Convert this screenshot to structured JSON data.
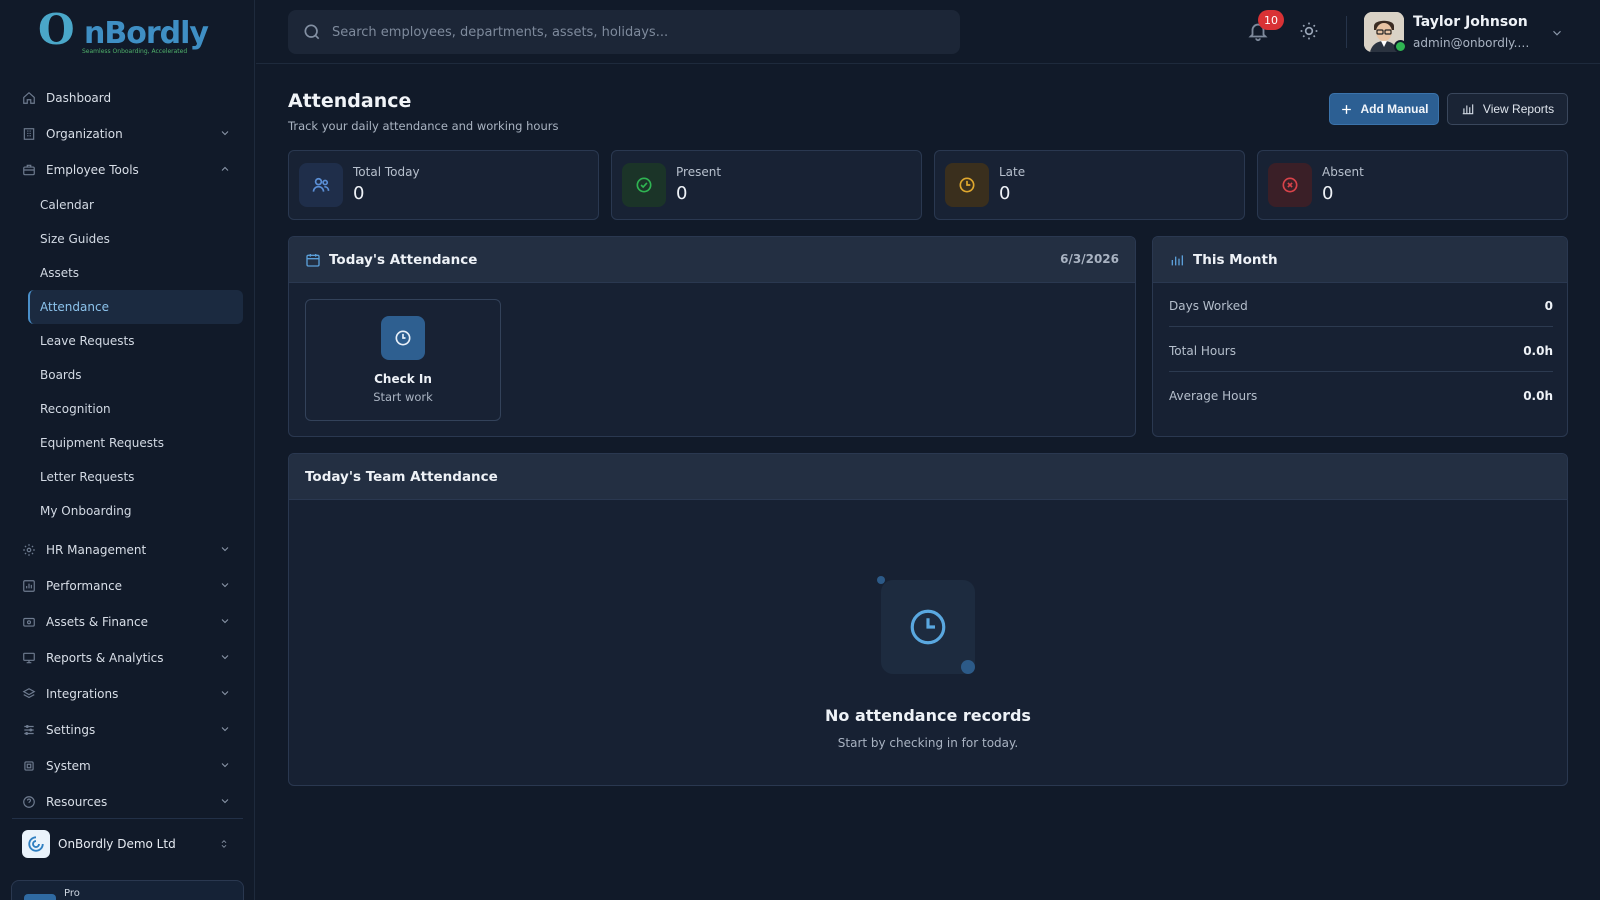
{
  "app": {
    "logo_mark": "O",
    "logo_word": "nBordly",
    "tagline": "Seamless Onboarding, Accelerated"
  },
  "sidebar": {
    "items_top": [
      {
        "label": "Dashboard",
        "icon": "home-icon",
        "expandable": false
      },
      {
        "label": "Organization",
        "icon": "building-icon",
        "expandable": true
      },
      {
        "label": "Employee Tools",
        "icon": "briefcase-icon",
        "expandable": true,
        "expanded": true
      }
    ],
    "employee_tools": [
      "Calendar",
      "Size Guides",
      "Assets",
      "Attendance",
      "Leave Requests",
      "Boards",
      "Recognition",
      "Equipment Requests",
      "Letter Requests",
      "My Onboarding"
    ],
    "active_sub": "Attendance",
    "items_bottom": [
      {
        "label": "HR Management",
        "icon": "users-cog-icon"
      },
      {
        "label": "Performance",
        "icon": "chart-icon"
      },
      {
        "label": "Assets & Finance",
        "icon": "wallet-icon"
      },
      {
        "label": "Reports & Analytics",
        "icon": "report-icon"
      },
      {
        "label": "Integrations",
        "icon": "layers-icon"
      },
      {
        "label": "Settings",
        "icon": "sliders-icon"
      },
      {
        "label": "System",
        "icon": "cpu-icon"
      },
      {
        "label": "Resources",
        "icon": "help-icon"
      }
    ],
    "org_name": "OnBordly Demo Ltd",
    "plan_label": "Pro"
  },
  "topbar": {
    "search_placeholder": "Search employees, departments, assets, holidays...",
    "notification_count": "10",
    "user_name": "Taylor Johnson",
    "user_email": "admin@onbordly.de..."
  },
  "page": {
    "title": "Attendance",
    "subtitle": "Track your daily attendance and working hours",
    "add_manual_label": "Add Manual",
    "view_reports_label": "View Reports"
  },
  "stats": [
    {
      "label": "Total Today",
      "value": "0",
      "color": "#4a7fc1",
      "icon": "users-icon"
    },
    {
      "label": "Present",
      "value": "0",
      "color": "#2fb552",
      "icon": "check-circle-icon"
    },
    {
      "label": "Late",
      "value": "0",
      "color": "#e0a82e",
      "icon": "clock-icon"
    },
    {
      "label": "Absent",
      "value": "0",
      "color": "#d9434a",
      "icon": "x-circle-icon"
    }
  ],
  "today": {
    "title": "Today's Attendance",
    "date": "6/3/2026",
    "check_in_label": "Check In",
    "check_in_sub": "Start work"
  },
  "month": {
    "title": "This Month",
    "rows": [
      {
        "label": "Days Worked",
        "value": "0"
      },
      {
        "label": "Total Hours",
        "value": "0.0h"
      },
      {
        "label": "Average Hours",
        "value": "0.0h"
      }
    ]
  },
  "team": {
    "title": "Today's Team Attendance",
    "empty_title": "No attendance records",
    "empty_sub": "Start by checking in for today."
  },
  "colors": {
    "accent": "#2c5f93",
    "background": "#111a29",
    "card": "#172133"
  }
}
